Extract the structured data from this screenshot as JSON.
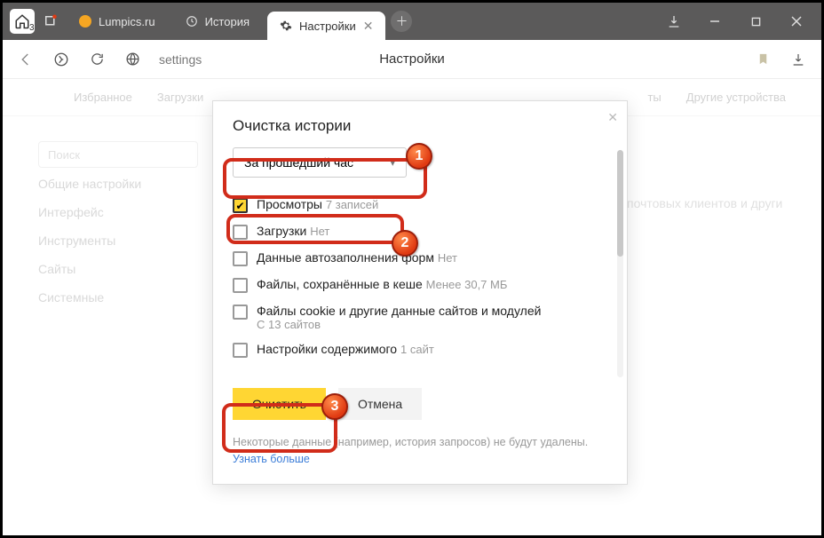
{
  "titlebar": {
    "home_badge": "3",
    "tabs": [
      {
        "label": "Lumpics.ru",
        "active": false
      },
      {
        "label": "История",
        "active": false
      },
      {
        "label": "Настройки",
        "active": true
      }
    ]
  },
  "toolbar": {
    "address": "settings",
    "page_title": "Настройки"
  },
  "settings": {
    "nav": [
      "Избранное",
      "Загрузки",
      "",
      "",
      "",
      "",
      "Другие устройства"
    ],
    "nav_overflow_label": "ты",
    "search_placeholder": "Поиск",
    "sidebar": [
      "Общие настройки",
      "Интерфейс",
      "Инструменты",
      "Сайты",
      "Системные"
    ],
    "content_snippet": "ов, почтовых клиентов и други"
  },
  "modal": {
    "title": "Очистка истории",
    "dropdown_value": "За прошедший час",
    "items": [
      {
        "label": "Просмотры",
        "hint": "7 записей",
        "checked": true
      },
      {
        "label": "Загрузки",
        "hint": "Нет",
        "checked": false
      },
      {
        "label": "Данные автозаполнения форм",
        "hint": "Нет",
        "checked": false
      },
      {
        "label": "Файлы, сохранённые в кеше",
        "hint": "Менее 30,7 МБ",
        "checked": false
      },
      {
        "label": "Файлы cookie и другие данные сайтов и модулей",
        "sub": "С 13 сайтов",
        "checked": false
      },
      {
        "label": "Настройки содержимого",
        "hint": "1 сайт",
        "checked": false
      }
    ],
    "primary_btn": "Очистить",
    "secondary_btn": "Отмена",
    "note_text": "Некоторые данные (например, история запросов) не будут удалены.",
    "note_link": "Узнать больше"
  },
  "annotations": {
    "b1": "1",
    "b2": "2",
    "b3": "3"
  }
}
